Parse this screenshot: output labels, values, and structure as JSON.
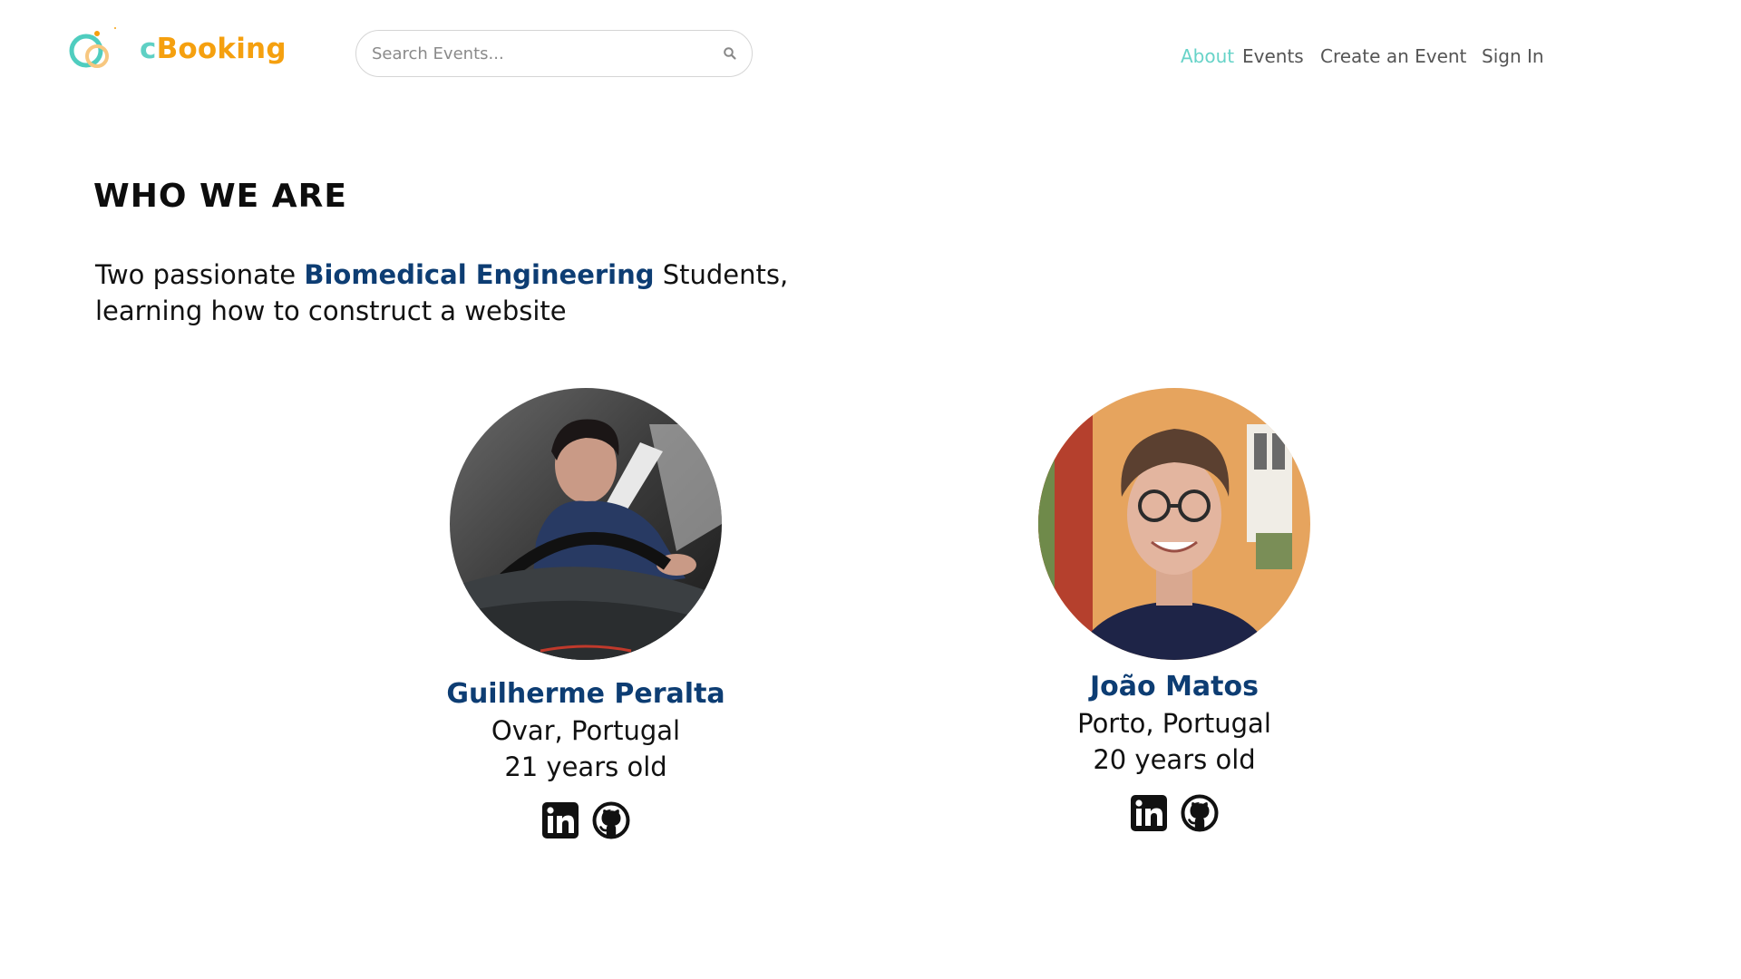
{
  "header": {
    "logo": {
      "prefix": "c",
      "rest": "Booking"
    },
    "search": {
      "placeholder": "Search Events..."
    },
    "nav": [
      {
        "label": "About",
        "active": true
      },
      {
        "label": "Events",
        "active": false
      },
      {
        "label": "Create an Event",
        "active": false
      },
      {
        "label": "Sign In",
        "active": false
      }
    ]
  },
  "main": {
    "heading": "WHO WE ARE",
    "intro": {
      "before": "Two passionate ",
      "highlight": "Biomedical Engineering",
      "after": " Students, learning how to construct a website"
    },
    "members": [
      {
        "name": "Guilherme Peralta",
        "location": "Ovar, Portugal",
        "age": "21 years old",
        "links": [
          "linkedin-icon",
          "github-icon"
        ]
      },
      {
        "name": "João Matos",
        "location": "Porto, Portugal",
        "age": "20 years old",
        "links": [
          "linkedin-icon",
          "github-icon"
        ]
      }
    ]
  },
  "colors": {
    "accent_teal": "#67d3c8",
    "brand_orange": "#f5a00f",
    "name_blue": "#0d3d73",
    "nav_gray": "#555555"
  }
}
